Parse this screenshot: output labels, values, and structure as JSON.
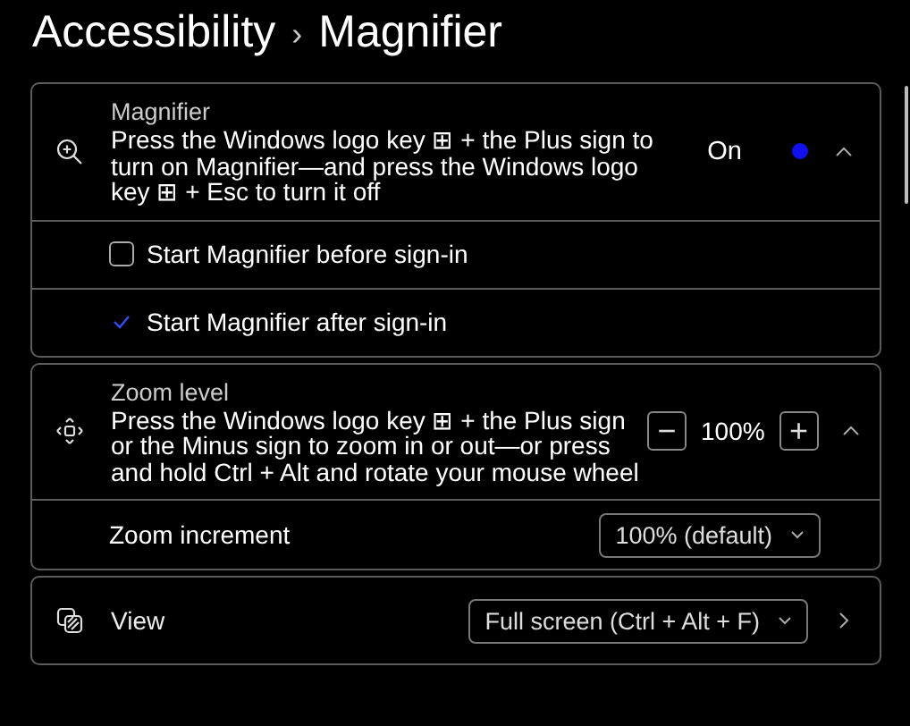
{
  "breadcrumb": {
    "parent": "Accessibility",
    "separator": "›",
    "current": "Magnifier"
  },
  "sections": [
    {
      "kind": "toggle",
      "title": "Magnifier",
      "description": "Press the Windows logo key ⊞ + the Plus sign to turn on Magnifier—and press the Windows logo key ⊞ + Esc to turn it off",
      "state_label": "On",
      "on": true,
      "expanded": true,
      "options": [
        {
          "label": "Start Magnifier before sign-in",
          "checked": false
        },
        {
          "label": "Start Magnifier after sign-in",
          "checked": true
        }
      ]
    },
    {
      "kind": "stepper",
      "title": "Zoom level",
      "description": "Press the Windows logo key ⊞ + the Plus sign or the Minus sign to zoom in or out—or press and hold Ctrl + Alt and rotate your mouse wheel",
      "minus": "−",
      "value": "100%",
      "plus": "+",
      "expanded": true,
      "settings": [
        {
          "label": "Zoom increment",
          "value": "100% (default)"
        }
      ]
    },
    {
      "kind": "select",
      "title": "View",
      "value": "Full screen (Ctrl + Alt + F)"
    }
  ]
}
